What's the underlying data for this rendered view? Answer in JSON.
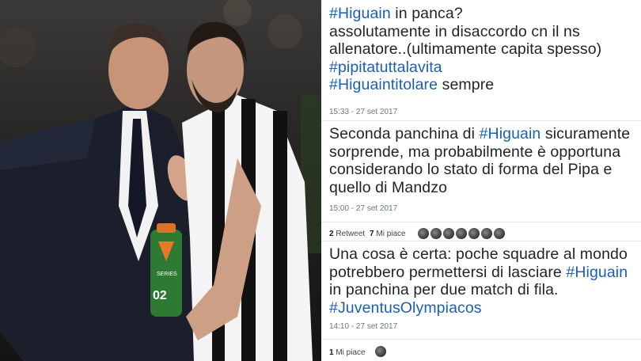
{
  "tweets": [
    {
      "lines": [
        [
          {
            "t": "#Higuain",
            "h": true
          },
          {
            "t": " in panca?",
            "h": false
          }
        ],
        [
          {
            "t": "assolutamente in disaccordo cn il ns",
            "h": false
          }
        ],
        [
          {
            "t": "allenatore..(ultimamente capita spesso)",
            "h": false
          }
        ],
        [
          {
            "t": "#pipitatuttalavita",
            "h": true
          }
        ],
        [
          {
            "t": "#Higuaintitolare",
            "h": true
          },
          {
            "t": " sempre",
            "h": false
          }
        ]
      ],
      "time": "15:33 - 27 set 2017"
    },
    {
      "lines": [
        [
          {
            "t": "Seconda panchina di ",
            "h": false
          },
          {
            "t": "#Higuain",
            "h": true
          },
          {
            "t": " sicuramente",
            "h": false
          }
        ],
        [
          {
            "t": "sorprende, ma probabilmente è opportuna",
            "h": false
          }
        ],
        [
          {
            "t": "considerando lo stato di forma del Pipa e",
            "h": false
          }
        ],
        [
          {
            "t": "quello di Mandzo",
            "h": false
          }
        ]
      ],
      "time": "15:00 - 27 set 2017",
      "stats": {
        "retweets_count": "2",
        "retweets_label": "Retweet",
        "likes_count": "7",
        "likes_label": "Mi piace"
      }
    },
    {
      "lines": [
        [
          {
            "t": "Una cosa è certa: poche squadre al mondo",
            "h": false
          }
        ],
        [
          {
            "t": "potrebbero permettersi di lasciare ",
            "h": false
          },
          {
            "t": "#Higuain",
            "h": true
          }
        ],
        [
          {
            "t": "in panchina per due match di fila.",
            "h": false
          }
        ],
        [
          {
            "t": "#JuventusOlympiacos",
            "h": true
          }
        ]
      ],
      "time": "14:10 - 27 set 2017",
      "stats": {
        "likes_count": "1",
        "likes_label": "Mi piace"
      }
    }
  ],
  "photo": {
    "bottle_text": "02",
    "bottle_brand": "SERIES"
  },
  "colors": {
    "hashtag": "#1b5fb4",
    "text": "#1f2328",
    "meta": "#657786"
  }
}
